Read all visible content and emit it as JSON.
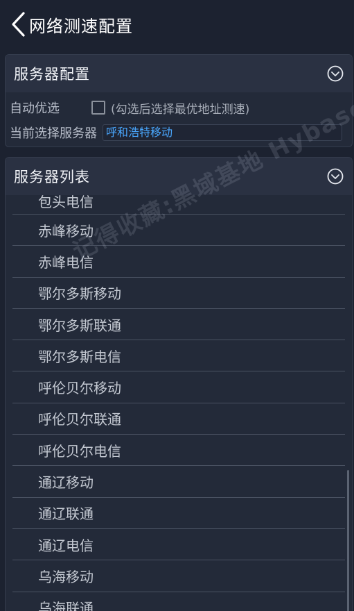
{
  "header": {
    "title": "网络测速配置",
    "back_icon": "chevron-left-icon"
  },
  "server_config": {
    "title": "服务器配置",
    "auto_select_label": "自动优选",
    "auto_select_checked": false,
    "auto_select_hint": "(勾选后选择最优地址测速)",
    "current_server_label": "当前选择服务器",
    "current_server_value": "呼和浩特移动"
  },
  "server_list": {
    "title": "服务器列表",
    "items": [
      "包头电信",
      "赤峰移动",
      "赤峰电信",
      "鄂尔多斯移动",
      "鄂尔多斯联通",
      "鄂尔多斯电信",
      "呼伦贝尔移动",
      "呼伦贝尔联通",
      "呼伦贝尔电信",
      "通辽移动",
      "通辽联通",
      "通辽电信",
      "乌海移动",
      "乌海联通"
    ]
  },
  "watermark": "记得收藏:黑域基地 Hybase.com",
  "colors": {
    "background": "#1c2230",
    "accent": "#4aa8ff"
  }
}
